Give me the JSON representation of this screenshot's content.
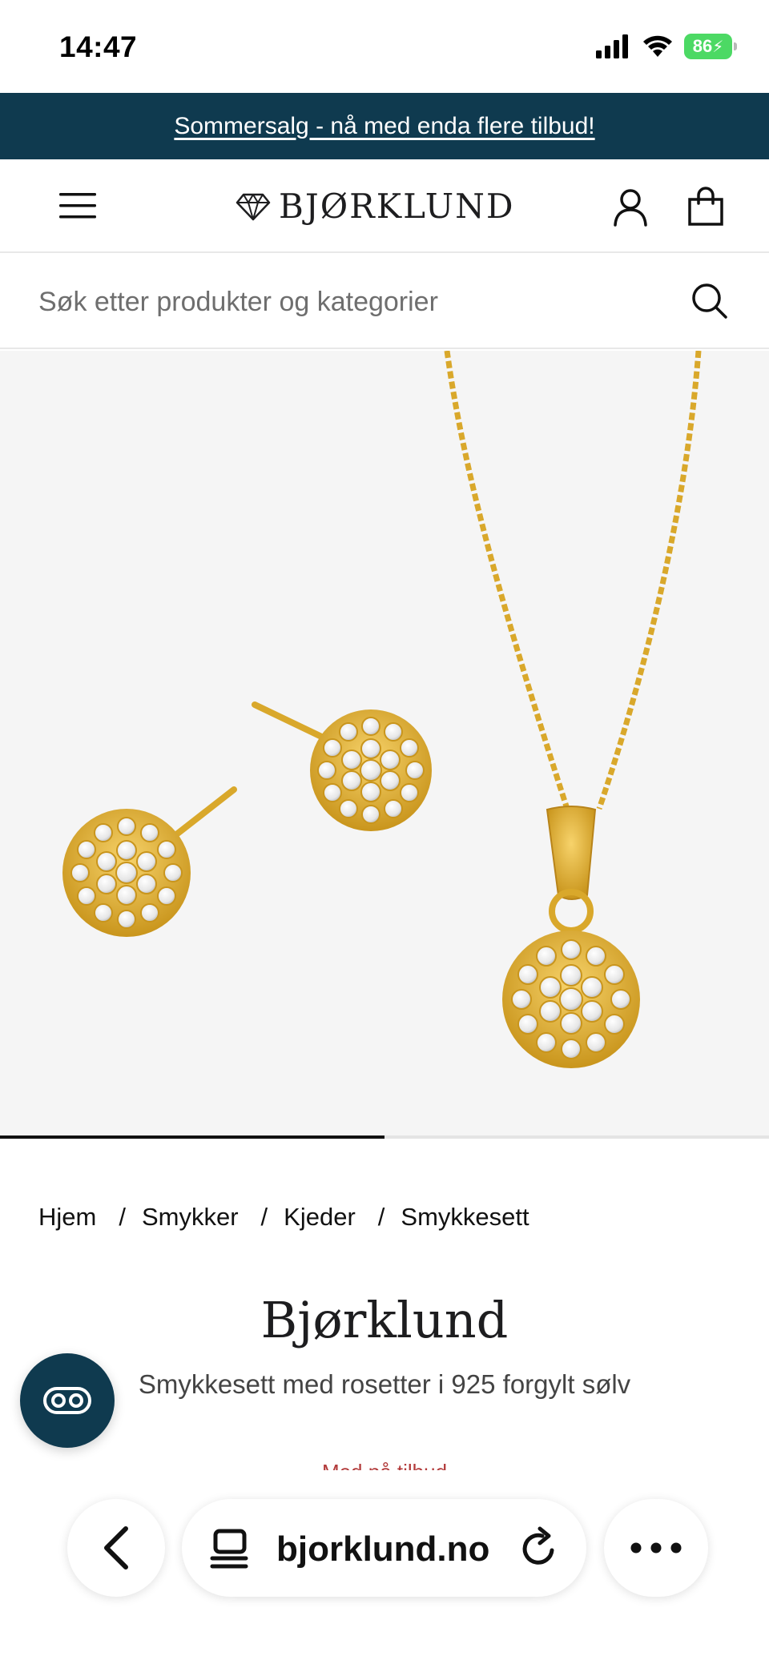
{
  "status_bar": {
    "time": "14:47",
    "battery": "86",
    "icons": [
      "signal-icon",
      "wifi-icon",
      "battery-charging-icon"
    ]
  },
  "promo": {
    "text": "Sommersalg - nå med enda flere tilbud!",
    "bg_color": "#0f3a4f"
  },
  "header": {
    "brand": "BJØRKLUND",
    "icons": [
      "menu-icon",
      "diamond-logo-icon",
      "account-icon",
      "shopping-bag-icon"
    ]
  },
  "search": {
    "placeholder": "Søk etter produkter og kategorier",
    "icon": "search-icon"
  },
  "gallery": {
    "progress": 0.5
  },
  "breadcrumb": {
    "items": [
      "Hjem",
      "Smykker",
      "Kjeder",
      "Smykkesett"
    ],
    "separator": "/"
  },
  "product": {
    "brand": "Bjørklund",
    "name": "Smykkesett med rosetter i 925 forgylt sølv",
    "sale_text": "Med på tilbud"
  },
  "browser": {
    "url": "bjorklund.no",
    "icons": [
      "back-chevron-icon",
      "tabs-icon",
      "reload-icon",
      "more-icon"
    ]
  }
}
